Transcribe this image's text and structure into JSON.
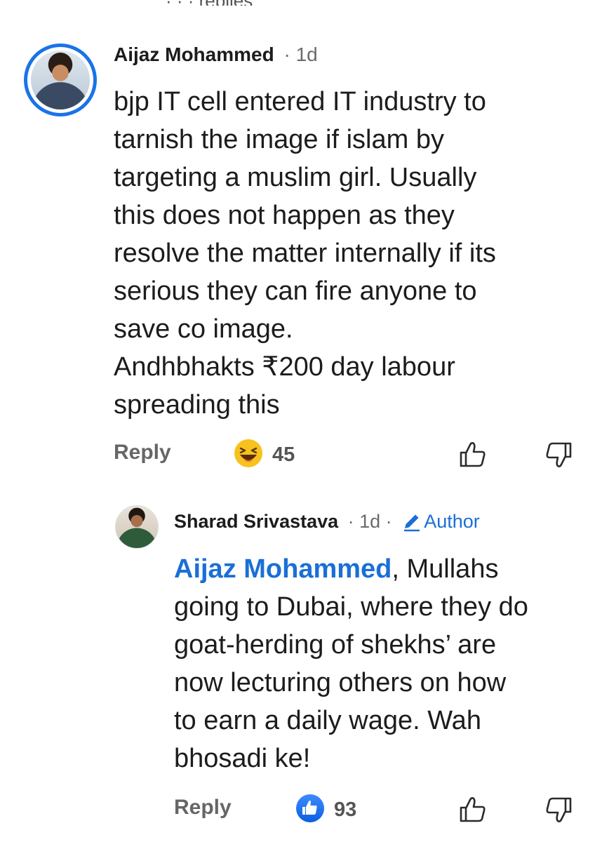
{
  "top_partial_text": "· · · replies",
  "comments": [
    {
      "author": "Aijaz Mohammed",
      "meta": "· 1d",
      "lines": [
        "bjp IT cell entered IT industry to",
        "tarnish the image if islam by",
        "targeting a muslim girl. Usually",
        "this does not happen as they",
        "resolve the matter internally if its",
        "serious they can fire anyone to",
        "save co image.",
        "Andhbhakts ₹200 day labour",
        "spreading this"
      ],
      "reply_label": "Reply",
      "reaction_icon": "laughing-emoji-icon",
      "reaction_count": "45"
    },
    {
      "author": "Sharad Srivastava",
      "meta": "· 1d ·",
      "author_badge": "Author",
      "mention": "Aijaz Mohammed",
      "text_after_mention": ", Mullahs",
      "lines": [
        "going to Dubai, where they do",
        "goat-herding of shekhs’ are",
        "now lecturing others on how",
        "to earn a daily wage. Wah",
        "bhosadi ke!"
      ],
      "reply_label": "Reply",
      "reaction_icon": "like-reaction-icon",
      "reaction_count": "93"
    }
  ],
  "colors": {
    "accent_blue": "#1a6fd6",
    "text": "#1c1c1c",
    "muted": "#6b6b6b"
  }
}
